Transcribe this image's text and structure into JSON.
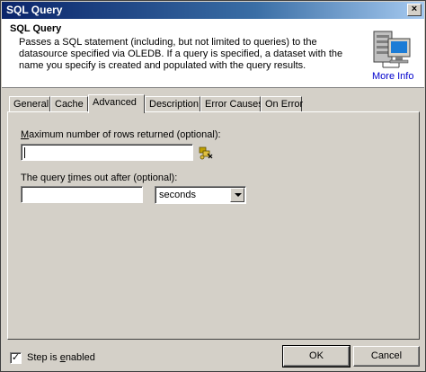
{
  "window": {
    "title": "SQL Query",
    "close_glyph": "×"
  },
  "header": {
    "title": "SQL Query",
    "description": "Passes a SQL statement (including, but not limited to queries) to the datasource specified via OLEDB.  If a query is specified, a dataset with the name you specify is created and populated with the query results.",
    "more_info": "More Info",
    "icon": "server-computer-icon"
  },
  "tabs": [
    {
      "label": "General"
    },
    {
      "label": "Cache"
    },
    {
      "label": "Advanced",
      "active": true
    },
    {
      "label": "Description"
    },
    {
      "label": "Error Causes"
    },
    {
      "label": "On Error"
    }
  ],
  "advanced": {
    "max_rows_label_u": "M",
    "max_rows_label_rest": "aximum number of rows returned (optional):",
    "max_rows_value": "",
    "timeout_label_pre": "The query ",
    "timeout_label_u": "t",
    "timeout_label_post": "imes out after (optional):",
    "timeout_value": "",
    "timeout_unit": "seconds",
    "variable_icon": "variable-picker-icon"
  },
  "footer": {
    "step_enabled_pre": "Step is ",
    "step_enabled_u": "e",
    "step_enabled_post": "nabled",
    "step_enabled_checked": true,
    "check_glyph": "✓",
    "ok": "OK",
    "cancel": "Cancel"
  }
}
